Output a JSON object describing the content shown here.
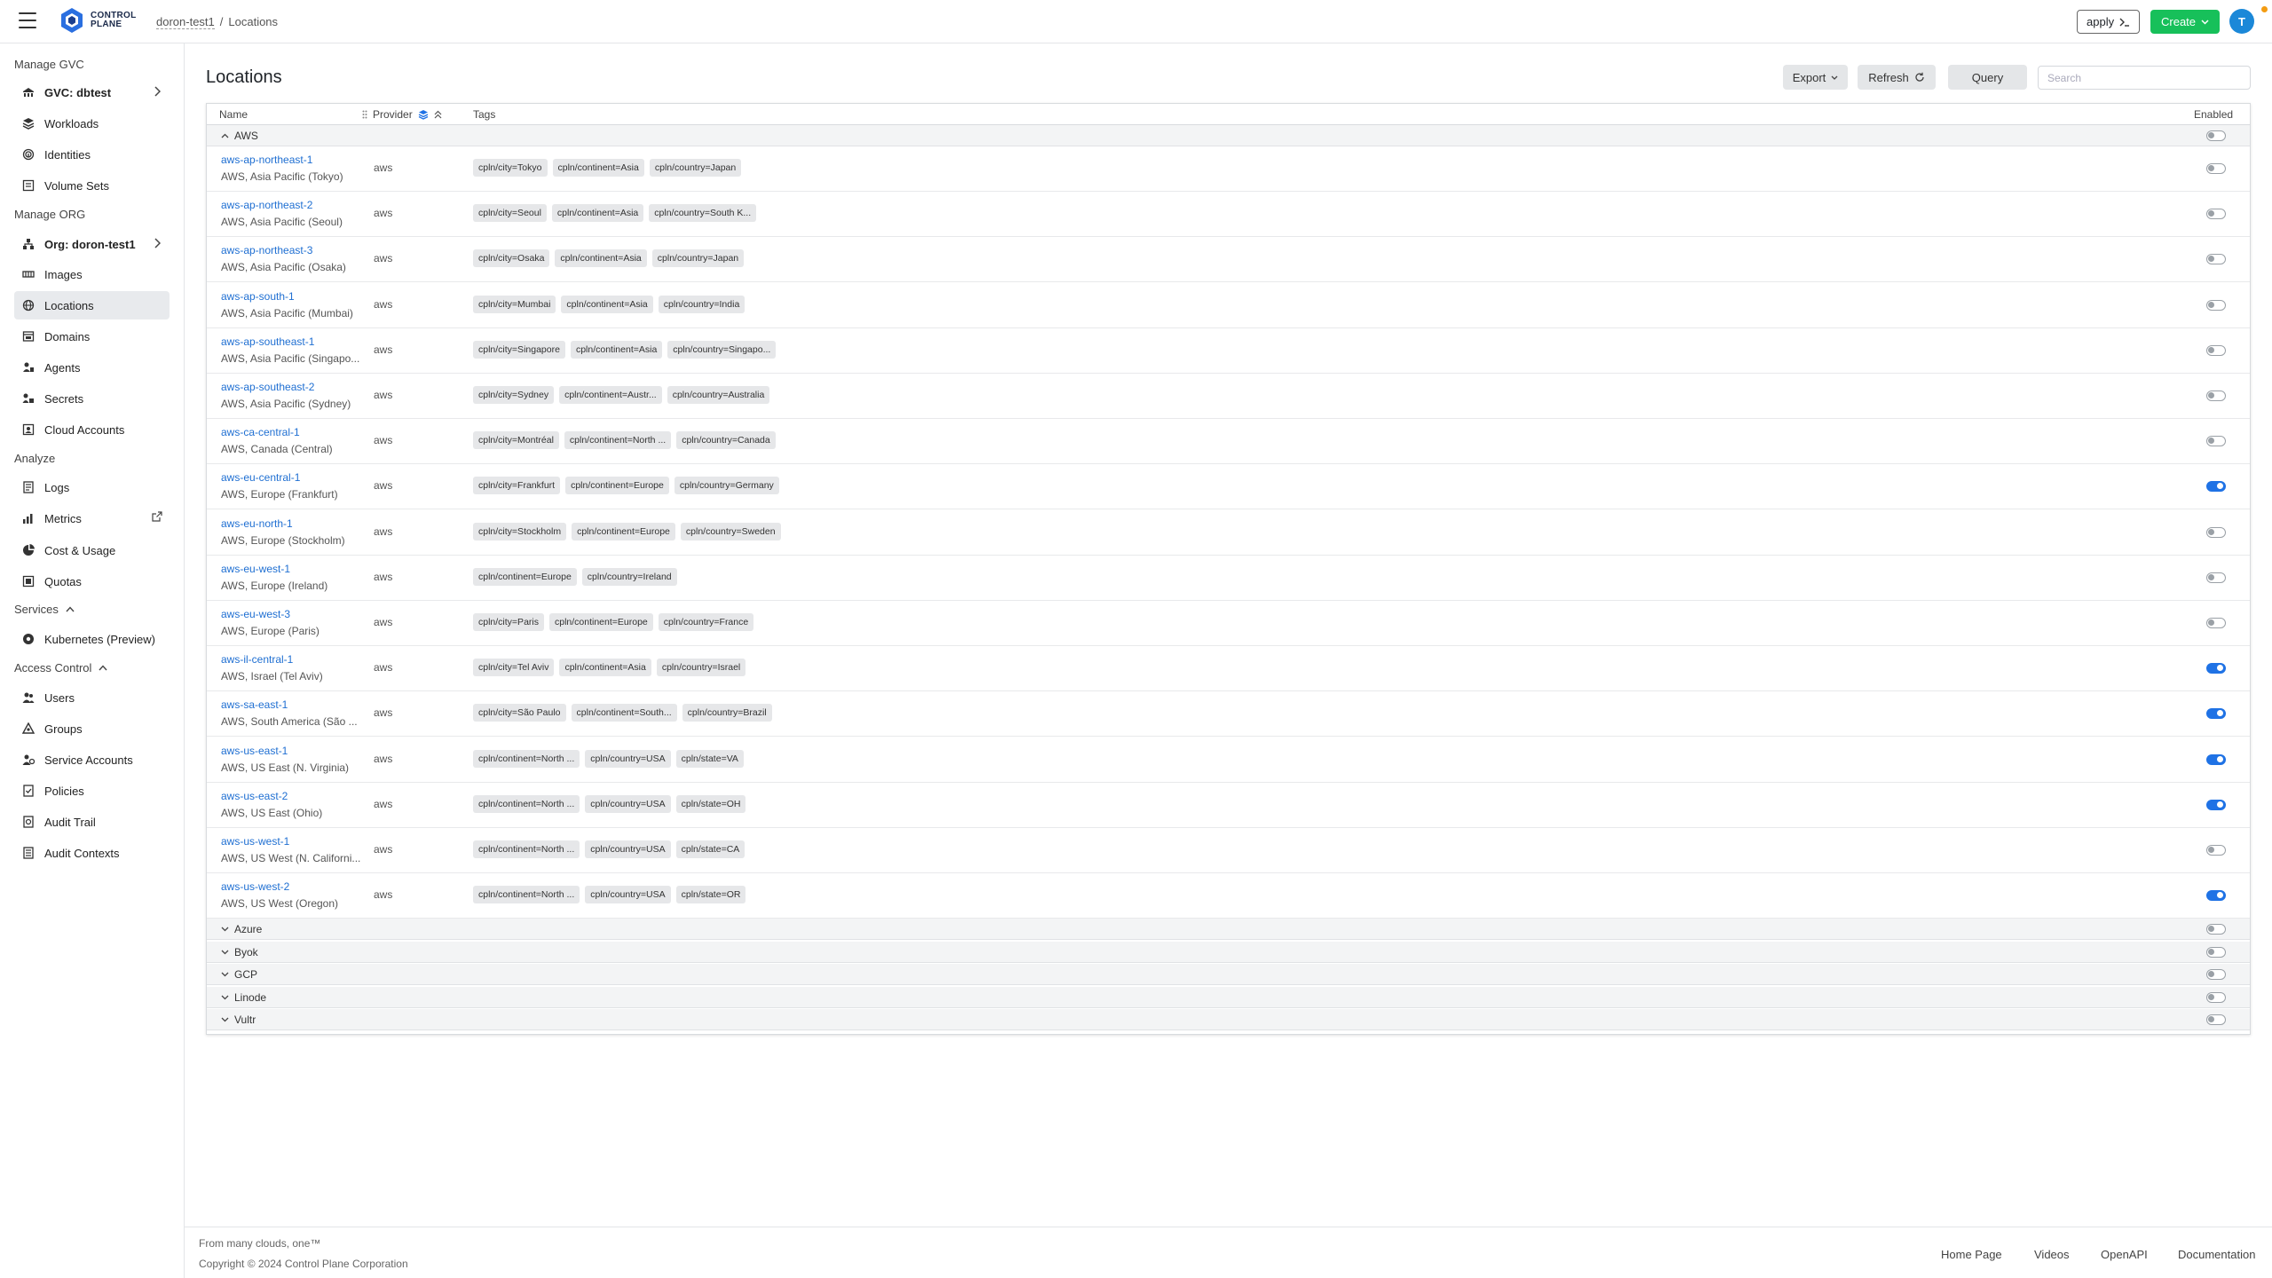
{
  "header": {
    "logo_line1": "CONTROL",
    "logo_line2": "PLANE",
    "breadcrumb_org": "doron-test1",
    "breadcrumb_sep": "/",
    "breadcrumb_page": "Locations",
    "apply_label": "apply",
    "create_label": "Create",
    "avatar_initial": "T"
  },
  "sidebar": {
    "manage_gvc": "Manage GVC",
    "gvc_item": "GVC: dbtest",
    "workloads": "Workloads",
    "identities": "Identities",
    "volume_sets": "Volume Sets",
    "manage_org": "Manage ORG",
    "org_item": "Org: doron-test1",
    "images": "Images",
    "locations": "Locations",
    "domains": "Domains",
    "agents": "Agents",
    "secrets": "Secrets",
    "cloud_accounts": "Cloud Accounts",
    "analyze": "Analyze",
    "logs": "Logs",
    "metrics": "Metrics",
    "cost_usage": "Cost & Usage",
    "quotas": "Quotas",
    "services": "Services",
    "kubernetes": "Kubernetes (Preview)",
    "access_control": "Access Control",
    "users": "Users",
    "groups": "Groups",
    "service_accounts": "Service Accounts",
    "policies": "Policies",
    "audit_trail": "Audit Trail",
    "audit_contexts": "Audit Contexts"
  },
  "main": {
    "title": "Locations",
    "export_label": "Export",
    "refresh_label": "Refresh",
    "query_label": "Query",
    "search_placeholder": "Search"
  },
  "table": {
    "col_name": "Name",
    "col_provider": "Provider",
    "col_tags": "Tags",
    "col_enabled": "Enabled",
    "group_aws": "AWS",
    "groups_collapsed": [
      "Azure",
      "Byok",
      "GCP",
      "Linode",
      "Vultr"
    ],
    "rows": [
      {
        "name": "aws-ap-northeast-1",
        "desc": "AWS, Asia Pacific (Tokyo)",
        "provider": "aws",
        "tags": [
          "cpln/city=Tokyo",
          "cpln/continent=Asia",
          "cpln/country=Japan"
        ],
        "enabled": false
      },
      {
        "name": "aws-ap-northeast-2",
        "desc": "AWS, Asia Pacific (Seoul)",
        "provider": "aws",
        "tags": [
          "cpln/city=Seoul",
          "cpln/continent=Asia",
          "cpln/country=South K..."
        ],
        "enabled": false
      },
      {
        "name": "aws-ap-northeast-3",
        "desc": "AWS, Asia Pacific (Osaka)",
        "provider": "aws",
        "tags": [
          "cpln/city=Osaka",
          "cpln/continent=Asia",
          "cpln/country=Japan"
        ],
        "enabled": false
      },
      {
        "name": "aws-ap-south-1",
        "desc": "AWS, Asia Pacific (Mumbai)",
        "provider": "aws",
        "tags": [
          "cpln/city=Mumbai",
          "cpln/continent=Asia",
          "cpln/country=India"
        ],
        "enabled": false
      },
      {
        "name": "aws-ap-southeast-1",
        "desc": "AWS, Asia Pacific (Singapo...",
        "provider": "aws",
        "tags": [
          "cpln/city=Singapore",
          "cpln/continent=Asia",
          "cpln/country=Singapo..."
        ],
        "enabled": false
      },
      {
        "name": "aws-ap-southeast-2",
        "desc": "AWS, Asia Pacific (Sydney)",
        "provider": "aws",
        "tags": [
          "cpln/city=Sydney",
          "cpln/continent=Austr...",
          "cpln/country=Australia"
        ],
        "enabled": false
      },
      {
        "name": "aws-ca-central-1",
        "desc": "AWS, Canada (Central)",
        "provider": "aws",
        "tags": [
          "cpln/city=Montréal",
          "cpln/continent=North ...",
          "cpln/country=Canada"
        ],
        "enabled": false
      },
      {
        "name": "aws-eu-central-1",
        "desc": "AWS, Europe (Frankfurt)",
        "provider": "aws",
        "tags": [
          "cpln/city=Frankfurt",
          "cpln/continent=Europe",
          "cpln/country=Germany"
        ],
        "enabled": true
      },
      {
        "name": "aws-eu-north-1",
        "desc": "AWS, Europe (Stockholm)",
        "provider": "aws",
        "tags": [
          "cpln/city=Stockholm",
          "cpln/continent=Europe",
          "cpln/country=Sweden"
        ],
        "enabled": false
      },
      {
        "name": "aws-eu-west-1",
        "desc": "AWS, Europe (Ireland)",
        "provider": "aws",
        "tags": [
          "cpln/continent=Europe",
          "cpln/country=Ireland"
        ],
        "enabled": false
      },
      {
        "name": "aws-eu-west-3",
        "desc": "AWS, Europe (Paris)",
        "provider": "aws",
        "tags": [
          "cpln/city=Paris",
          "cpln/continent=Europe",
          "cpln/country=France"
        ],
        "enabled": false
      },
      {
        "name": "aws-il-central-1",
        "desc": "AWS, Israel (Tel Aviv)",
        "provider": "aws",
        "tags": [
          "cpln/city=Tel Aviv",
          "cpln/continent=Asia",
          "cpln/country=Israel"
        ],
        "enabled": true
      },
      {
        "name": "aws-sa-east-1",
        "desc": "AWS, South America (São ...",
        "provider": "aws",
        "tags": [
          "cpln/city=São Paulo",
          "cpln/continent=South...",
          "cpln/country=Brazil"
        ],
        "enabled": true
      },
      {
        "name": "aws-us-east-1",
        "desc": "AWS, US East (N. Virginia)",
        "provider": "aws",
        "tags": [
          "cpln/continent=North ...",
          "cpln/country=USA",
          "cpln/state=VA"
        ],
        "enabled": true
      },
      {
        "name": "aws-us-east-2",
        "desc": "AWS, US East (Ohio)",
        "provider": "aws",
        "tags": [
          "cpln/continent=North ...",
          "cpln/country=USA",
          "cpln/state=OH"
        ],
        "enabled": true
      },
      {
        "name": "aws-us-west-1",
        "desc": "AWS, US West (N. Californi...",
        "provider": "aws",
        "tags": [
          "cpln/continent=North ...",
          "cpln/country=USA",
          "cpln/state=CA"
        ],
        "enabled": false
      },
      {
        "name": "aws-us-west-2",
        "desc": "AWS, US West (Oregon)",
        "provider": "aws",
        "tags": [
          "cpln/continent=North ...",
          "cpln/country=USA",
          "cpln/state=OR"
        ],
        "enabled": true
      }
    ]
  },
  "footer": {
    "tagline": "From many clouds, one™",
    "copyright": "Copyright © 2024 Control Plane Corporation",
    "links": [
      "Home Page",
      "Videos",
      "OpenAPI",
      "Documentation"
    ]
  },
  "colors": {
    "accent": "#1f72e5",
    "create_green": "#17c05a",
    "link": "#1f6fd2"
  }
}
